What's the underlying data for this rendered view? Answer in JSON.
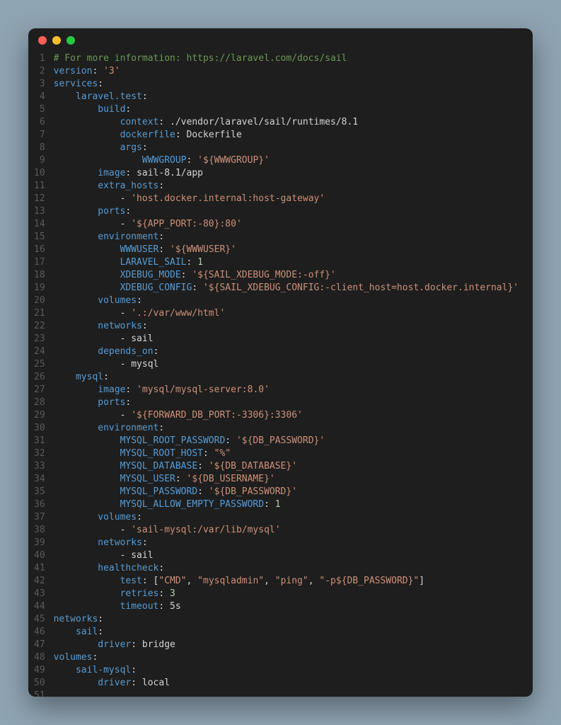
{
  "colors": {
    "background": "#8fa4b3",
    "editor_bg": "#1e1e1e",
    "gutter": "#5a5a5a",
    "comment": "#6a9955",
    "key": "#569cd6",
    "string": "#ce9178",
    "number": "#b5cea8",
    "plain": "#d4d4d4"
  },
  "window": {
    "buttons": [
      "close",
      "minimize",
      "zoom"
    ]
  },
  "total_lines": 51,
  "lines": [
    [
      {
        "c": "comment",
        "t": "# For more information: https://laravel.com/docs/sail"
      }
    ],
    [
      {
        "c": "key",
        "t": "version"
      },
      {
        "c": "punct",
        "t": ": "
      },
      {
        "c": "str",
        "t": "'3'"
      }
    ],
    [
      {
        "c": "key",
        "t": "services"
      },
      {
        "c": "punct",
        "t": ":"
      }
    ],
    [
      {
        "c": "plain",
        "t": "    "
      },
      {
        "c": "key",
        "t": "laravel.test"
      },
      {
        "c": "punct",
        "t": ":"
      }
    ],
    [
      {
        "c": "plain",
        "t": "        "
      },
      {
        "c": "key",
        "t": "build"
      },
      {
        "c": "punct",
        "t": ":"
      }
    ],
    [
      {
        "c": "plain",
        "t": "            "
      },
      {
        "c": "key",
        "t": "context"
      },
      {
        "c": "punct",
        "t": ": "
      },
      {
        "c": "plain",
        "t": "./vendor/laravel/sail/runtimes/8.1"
      }
    ],
    [
      {
        "c": "plain",
        "t": "            "
      },
      {
        "c": "key",
        "t": "dockerfile"
      },
      {
        "c": "punct",
        "t": ": "
      },
      {
        "c": "plain",
        "t": "Dockerfile"
      }
    ],
    [
      {
        "c": "plain",
        "t": "            "
      },
      {
        "c": "key",
        "t": "args"
      },
      {
        "c": "punct",
        "t": ":"
      }
    ],
    [
      {
        "c": "plain",
        "t": "                "
      },
      {
        "c": "key",
        "t": "WWWGROUP"
      },
      {
        "c": "punct",
        "t": ": "
      },
      {
        "c": "str",
        "t": "'${WWWGROUP}'"
      }
    ],
    [
      {
        "c": "plain",
        "t": "        "
      },
      {
        "c": "key",
        "t": "image"
      },
      {
        "c": "punct",
        "t": ": "
      },
      {
        "c": "plain",
        "t": "sail-8.1/app"
      }
    ],
    [
      {
        "c": "plain",
        "t": "        "
      },
      {
        "c": "key",
        "t": "extra_hosts"
      },
      {
        "c": "punct",
        "t": ":"
      }
    ],
    [
      {
        "c": "plain",
        "t": "            - "
      },
      {
        "c": "str",
        "t": "'host.docker.internal:host-gateway'"
      }
    ],
    [
      {
        "c": "plain",
        "t": "        "
      },
      {
        "c": "key",
        "t": "ports"
      },
      {
        "c": "punct",
        "t": ":"
      }
    ],
    [
      {
        "c": "plain",
        "t": "            - "
      },
      {
        "c": "str",
        "t": "'${APP_PORT:-80}:80'"
      }
    ],
    [
      {
        "c": "plain",
        "t": "        "
      },
      {
        "c": "key",
        "t": "environment"
      },
      {
        "c": "punct",
        "t": ":"
      }
    ],
    [
      {
        "c": "plain",
        "t": "            "
      },
      {
        "c": "key",
        "t": "WWWUSER"
      },
      {
        "c": "punct",
        "t": ": "
      },
      {
        "c": "str",
        "t": "'${WWWUSER}'"
      }
    ],
    [
      {
        "c": "plain",
        "t": "            "
      },
      {
        "c": "key",
        "t": "LARAVEL_SAIL"
      },
      {
        "c": "punct",
        "t": ": "
      },
      {
        "c": "num",
        "t": "1"
      }
    ],
    [
      {
        "c": "plain",
        "t": "            "
      },
      {
        "c": "key",
        "t": "XDEBUG_MODE"
      },
      {
        "c": "punct",
        "t": ": "
      },
      {
        "c": "str",
        "t": "'${SAIL_XDEBUG_MODE:-off}'"
      }
    ],
    [
      {
        "c": "plain",
        "t": "            "
      },
      {
        "c": "key",
        "t": "XDEBUG_CONFIG"
      },
      {
        "c": "punct",
        "t": ": "
      },
      {
        "c": "str",
        "t": "'${SAIL_XDEBUG_CONFIG:-client_host=host.docker.internal}'"
      }
    ],
    [
      {
        "c": "plain",
        "t": "        "
      },
      {
        "c": "key",
        "t": "volumes"
      },
      {
        "c": "punct",
        "t": ":"
      }
    ],
    [
      {
        "c": "plain",
        "t": "            - "
      },
      {
        "c": "str",
        "t": "'.:/var/www/html'"
      }
    ],
    [
      {
        "c": "plain",
        "t": "        "
      },
      {
        "c": "key",
        "t": "networks"
      },
      {
        "c": "punct",
        "t": ":"
      }
    ],
    [
      {
        "c": "plain",
        "t": "            - sail"
      }
    ],
    [
      {
        "c": "plain",
        "t": "        "
      },
      {
        "c": "key",
        "t": "depends_on"
      },
      {
        "c": "punct",
        "t": ":"
      }
    ],
    [
      {
        "c": "plain",
        "t": "            - mysql"
      }
    ],
    [
      {
        "c": "plain",
        "t": "    "
      },
      {
        "c": "key",
        "t": "mysql"
      },
      {
        "c": "punct",
        "t": ":"
      }
    ],
    [
      {
        "c": "plain",
        "t": "        "
      },
      {
        "c": "key",
        "t": "image"
      },
      {
        "c": "punct",
        "t": ": "
      },
      {
        "c": "str",
        "t": "'mysql/mysql-server:8.0'"
      }
    ],
    [
      {
        "c": "plain",
        "t": "        "
      },
      {
        "c": "key",
        "t": "ports"
      },
      {
        "c": "punct",
        "t": ":"
      }
    ],
    [
      {
        "c": "plain",
        "t": "            - "
      },
      {
        "c": "str",
        "t": "'${FORWARD_DB_PORT:-3306}:3306'"
      }
    ],
    [
      {
        "c": "plain",
        "t": "        "
      },
      {
        "c": "key",
        "t": "environment"
      },
      {
        "c": "punct",
        "t": ":"
      }
    ],
    [
      {
        "c": "plain",
        "t": "            "
      },
      {
        "c": "key",
        "t": "MYSQL_ROOT_PASSWORD"
      },
      {
        "c": "punct",
        "t": ": "
      },
      {
        "c": "str",
        "t": "'${DB_PASSWORD}'"
      }
    ],
    [
      {
        "c": "plain",
        "t": "            "
      },
      {
        "c": "key",
        "t": "MYSQL_ROOT_HOST"
      },
      {
        "c": "punct",
        "t": ": "
      },
      {
        "c": "str",
        "t": "\"%\""
      }
    ],
    [
      {
        "c": "plain",
        "t": "            "
      },
      {
        "c": "key",
        "t": "MYSQL_DATABASE"
      },
      {
        "c": "punct",
        "t": ": "
      },
      {
        "c": "str",
        "t": "'${DB_DATABASE}'"
      }
    ],
    [
      {
        "c": "plain",
        "t": "            "
      },
      {
        "c": "key",
        "t": "MYSQL_USER"
      },
      {
        "c": "punct",
        "t": ": "
      },
      {
        "c": "str",
        "t": "'${DB_USERNAME}'"
      }
    ],
    [
      {
        "c": "plain",
        "t": "            "
      },
      {
        "c": "key",
        "t": "MYSQL_PASSWORD"
      },
      {
        "c": "punct",
        "t": ": "
      },
      {
        "c": "str",
        "t": "'${DB_PASSWORD}'"
      }
    ],
    [
      {
        "c": "plain",
        "t": "            "
      },
      {
        "c": "key",
        "t": "MYSQL_ALLOW_EMPTY_PASSWORD"
      },
      {
        "c": "punct",
        "t": ": "
      },
      {
        "c": "num",
        "t": "1"
      }
    ],
    [
      {
        "c": "plain",
        "t": "        "
      },
      {
        "c": "key",
        "t": "volumes"
      },
      {
        "c": "punct",
        "t": ":"
      }
    ],
    [
      {
        "c": "plain",
        "t": "            - "
      },
      {
        "c": "str",
        "t": "'sail-mysql:/var/lib/mysql'"
      }
    ],
    [
      {
        "c": "plain",
        "t": "        "
      },
      {
        "c": "key",
        "t": "networks"
      },
      {
        "c": "punct",
        "t": ":"
      }
    ],
    [
      {
        "c": "plain",
        "t": "            - sail"
      }
    ],
    [
      {
        "c": "plain",
        "t": "        "
      },
      {
        "c": "key",
        "t": "healthcheck"
      },
      {
        "c": "punct",
        "t": ":"
      }
    ],
    [
      {
        "c": "plain",
        "t": "            "
      },
      {
        "c": "key",
        "t": "test"
      },
      {
        "c": "punct",
        "t": ": ["
      },
      {
        "c": "str",
        "t": "\"CMD\""
      },
      {
        "c": "punct",
        "t": ", "
      },
      {
        "c": "str",
        "t": "\"mysqladmin\""
      },
      {
        "c": "punct",
        "t": ", "
      },
      {
        "c": "str",
        "t": "\"ping\""
      },
      {
        "c": "punct",
        "t": ", "
      },
      {
        "c": "str",
        "t": "\"-p${DB_PASSWORD}\""
      },
      {
        "c": "punct",
        "t": "]"
      }
    ],
    [
      {
        "c": "plain",
        "t": "            "
      },
      {
        "c": "key",
        "t": "retries"
      },
      {
        "c": "punct",
        "t": ": "
      },
      {
        "c": "num",
        "t": "3"
      }
    ],
    [
      {
        "c": "plain",
        "t": "            "
      },
      {
        "c": "key",
        "t": "timeout"
      },
      {
        "c": "punct",
        "t": ": "
      },
      {
        "c": "plain",
        "t": "5s"
      }
    ],
    [
      {
        "c": "key",
        "t": "networks"
      },
      {
        "c": "punct",
        "t": ":"
      }
    ],
    [
      {
        "c": "plain",
        "t": "    "
      },
      {
        "c": "key",
        "t": "sail"
      },
      {
        "c": "punct",
        "t": ":"
      }
    ],
    [
      {
        "c": "plain",
        "t": "        "
      },
      {
        "c": "key",
        "t": "driver"
      },
      {
        "c": "punct",
        "t": ": "
      },
      {
        "c": "plain",
        "t": "bridge"
      }
    ],
    [
      {
        "c": "key",
        "t": "volumes"
      },
      {
        "c": "punct",
        "t": ":"
      }
    ],
    [
      {
        "c": "plain",
        "t": "    "
      },
      {
        "c": "key",
        "t": "sail-mysql"
      },
      {
        "c": "punct",
        "t": ":"
      }
    ],
    [
      {
        "c": "plain",
        "t": "        "
      },
      {
        "c": "key",
        "t": "driver"
      },
      {
        "c": "punct",
        "t": ": "
      },
      {
        "c": "plain",
        "t": "local"
      }
    ],
    []
  ]
}
